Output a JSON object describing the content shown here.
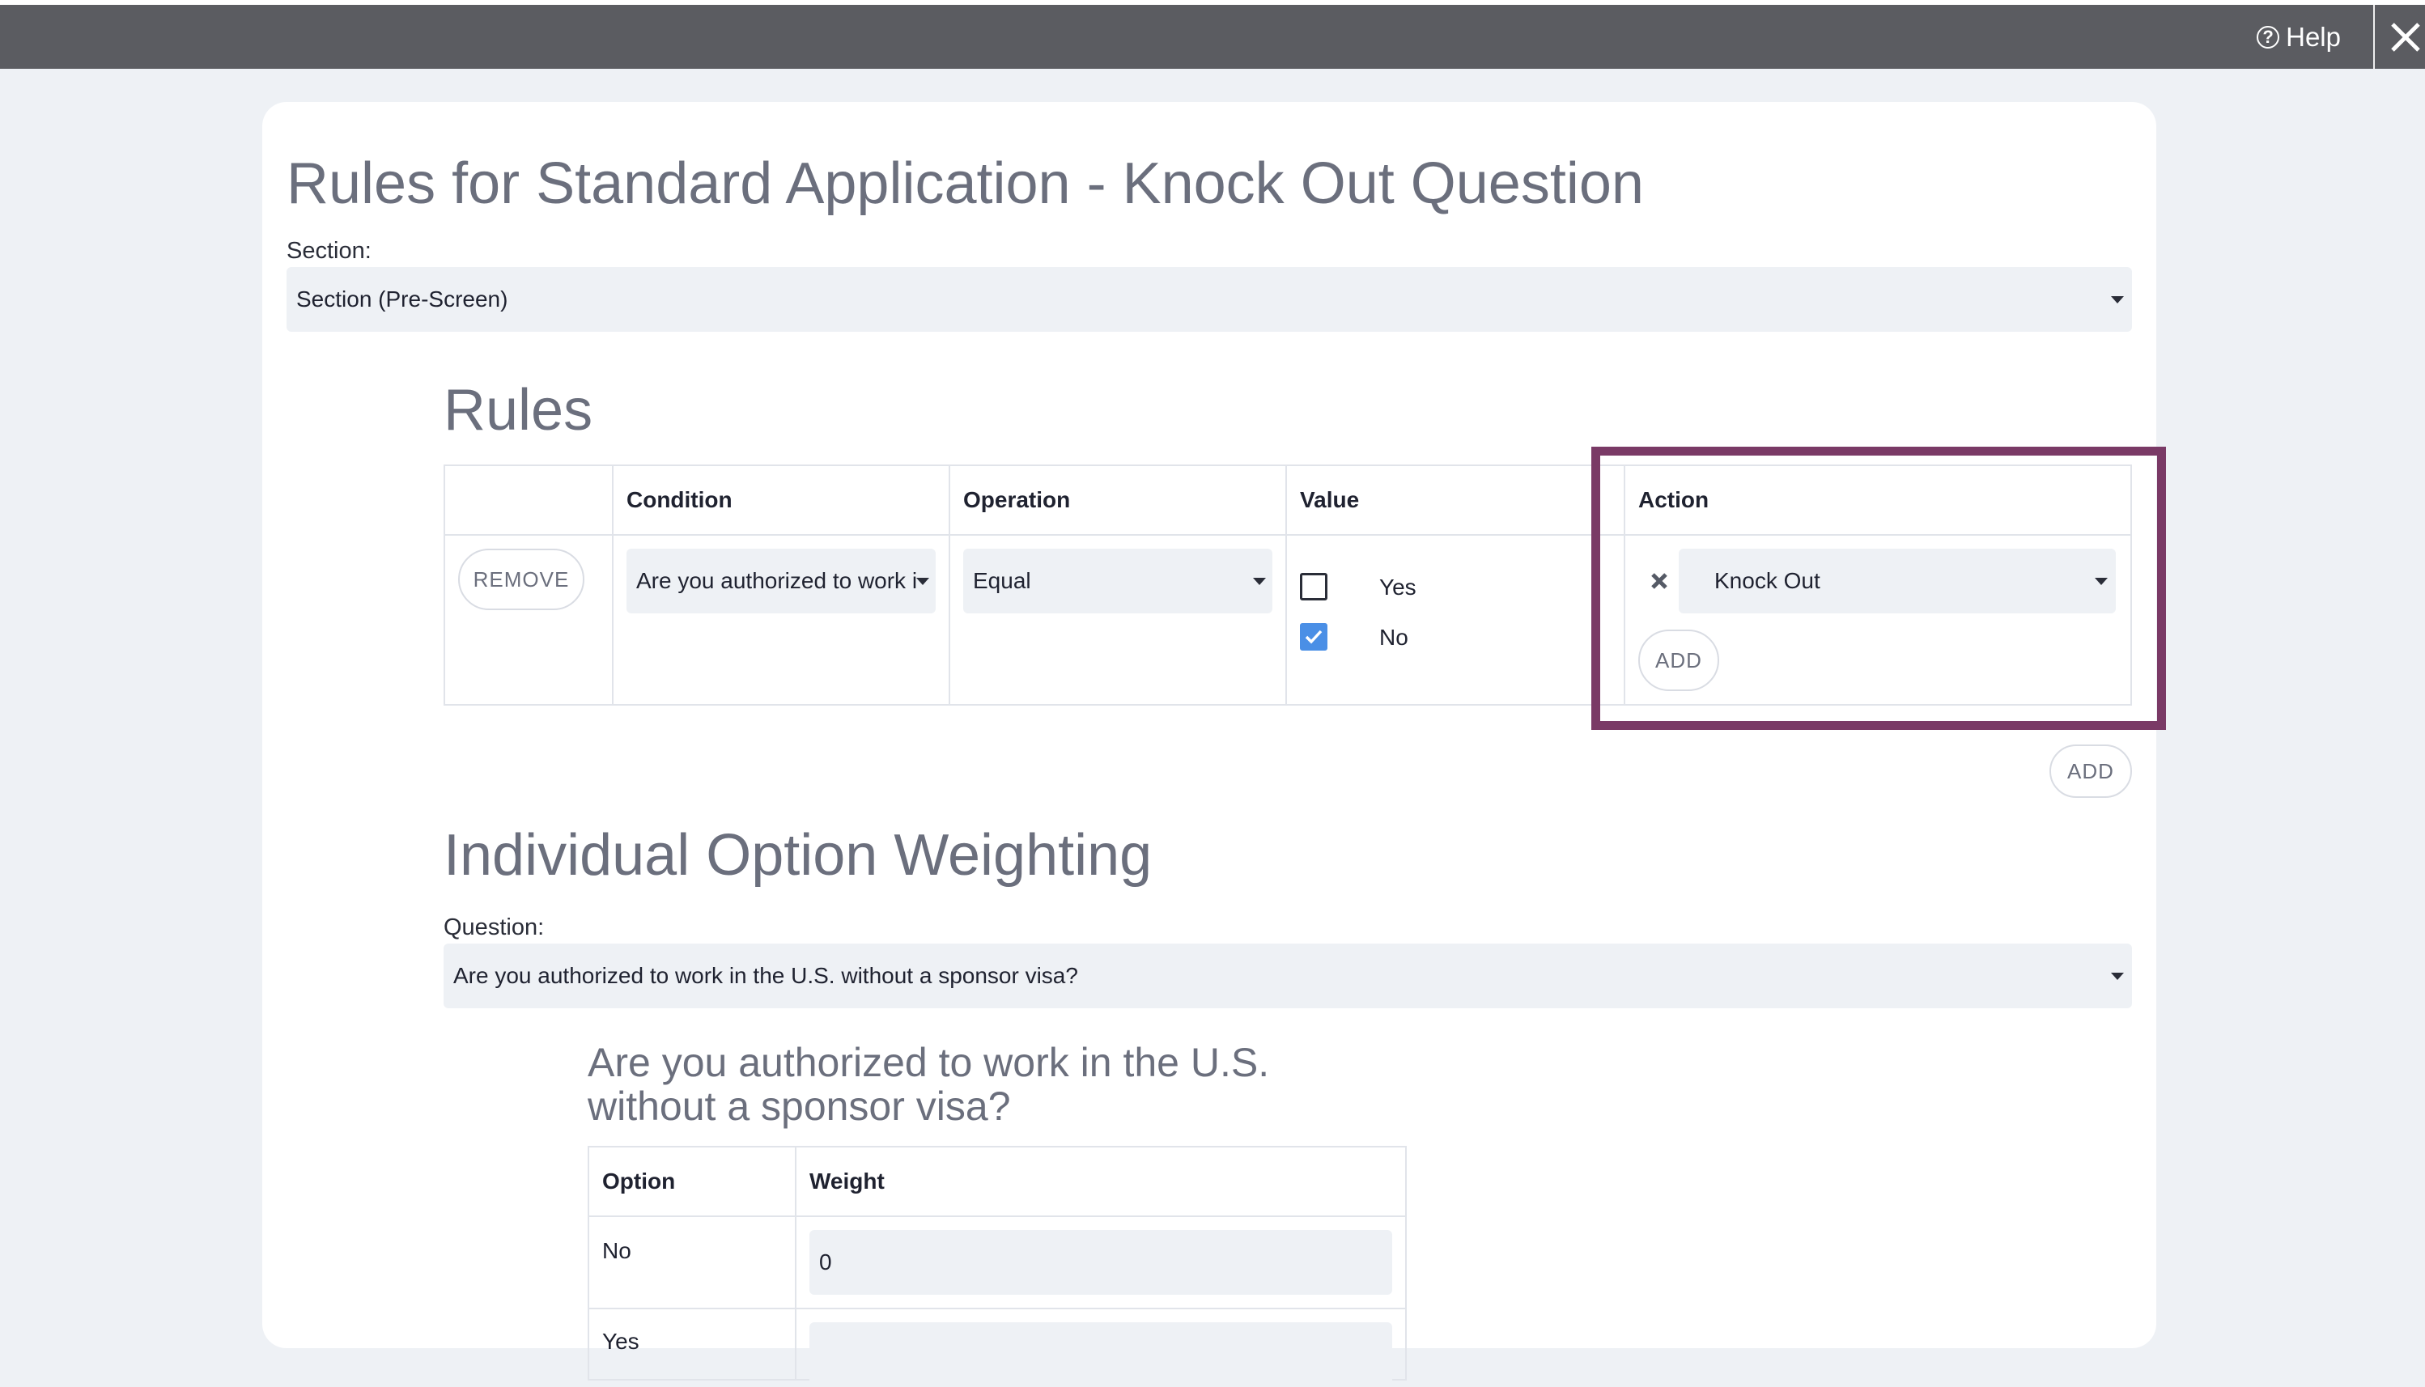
{
  "topbar": {
    "help_label": "Help",
    "help_icon": "question-circle-icon",
    "close_icon": "close-icon"
  },
  "page": {
    "title": "Rules for Standard Application - Knock Out Question",
    "section_label": "Section:",
    "section_value": "Section (Pre-Screen)"
  },
  "rules": {
    "heading": "Rules",
    "columns": [
      "",
      "Condition",
      "Operation",
      "Value",
      "Action"
    ],
    "row": {
      "remove_label": "REMOVE",
      "condition_value": "Are you authorized to work in the U.S. without a sponsor visa?",
      "operation_value": "Equal",
      "value_options": [
        {
          "label": "Yes",
          "checked": false
        },
        {
          "label": "No",
          "checked": true
        }
      ],
      "action_value": "Knock Out",
      "action_add_label": "ADD"
    },
    "add_label": "ADD",
    "highlight_color": "#7a3a66"
  },
  "weighting": {
    "heading": "Individual Option Weighting",
    "question_label": "Question:",
    "question_value": "Are you authorized to work in the U.S. without a sponsor visa?",
    "question_title_line1": "Are you authorized to work in the U.S.",
    "question_title_line2": "without a sponsor visa?",
    "columns": [
      "Option",
      "Weight"
    ],
    "rows": [
      {
        "option": "No",
        "weight": "0"
      },
      {
        "option": "Yes",
        "weight": ""
      }
    ]
  },
  "colors": {
    "accent": "#4a8fe6",
    "topbar": "#5b5c61"
  }
}
